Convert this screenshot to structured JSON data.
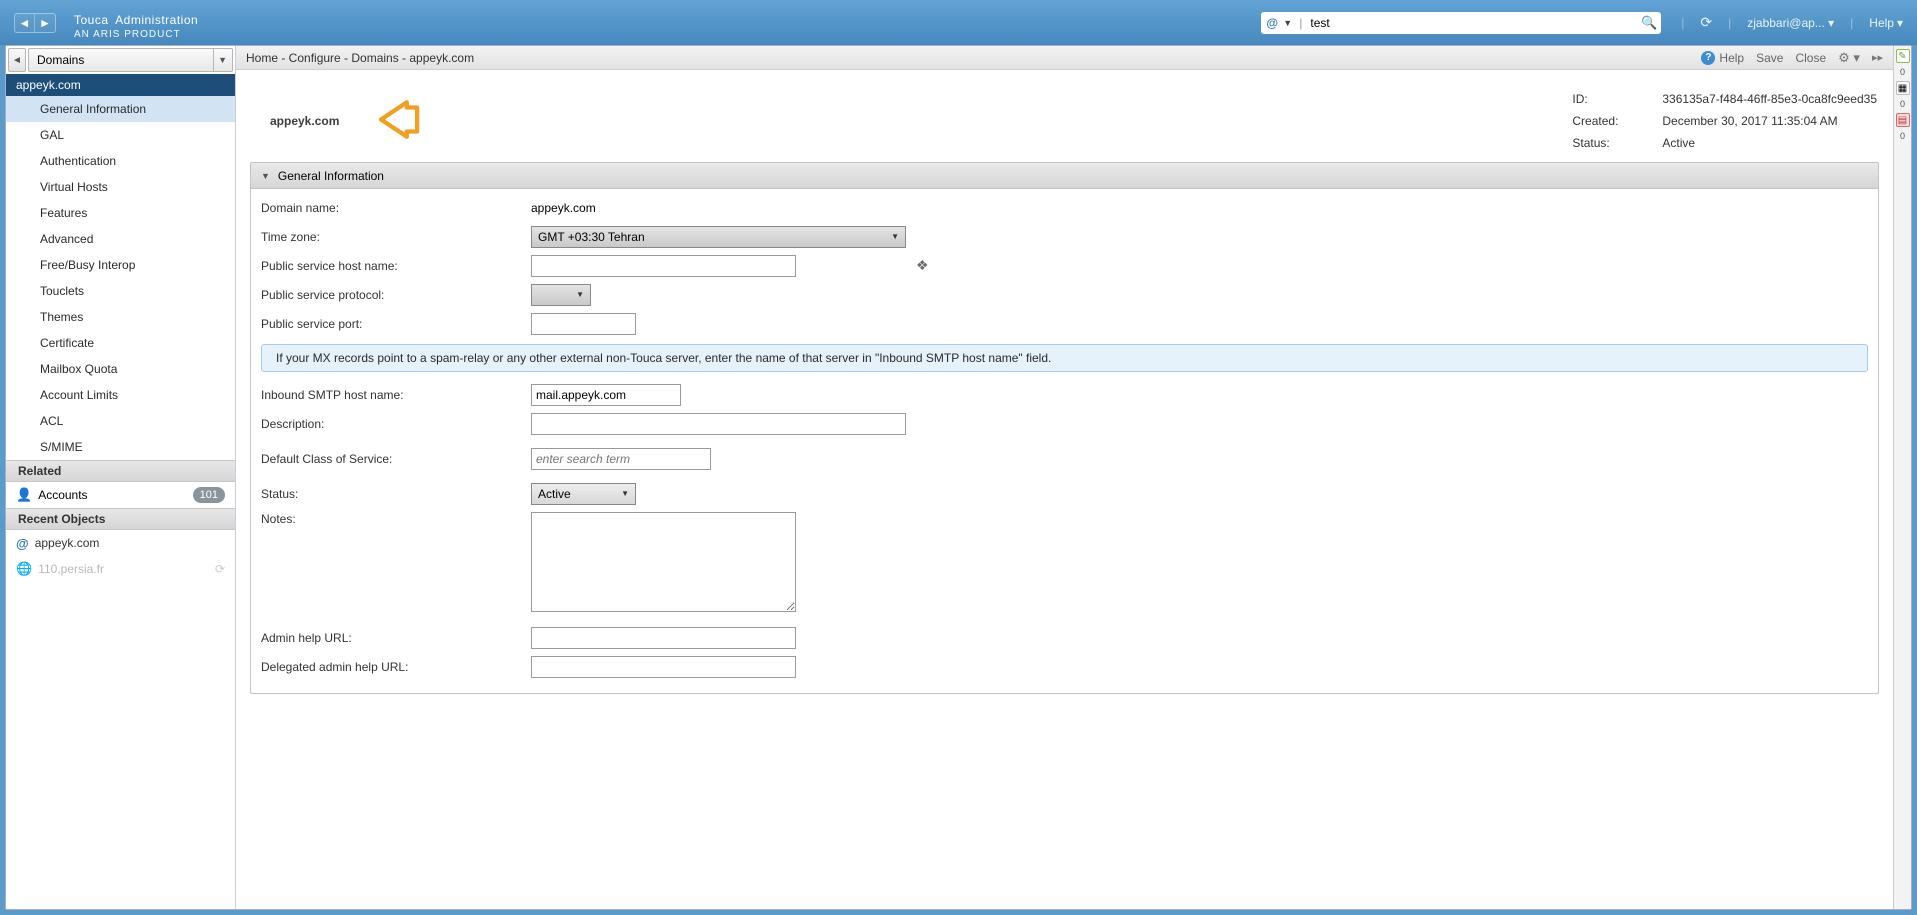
{
  "app": {
    "brand_main": "Touca",
    "brand_rest": "Administration",
    "brand_sub": "AN ARIS PRODUCT"
  },
  "topbar": {
    "search_prefix": "@",
    "search_value": "test",
    "refresh_tip": "Refresh",
    "user": "zjabbari@ap...",
    "help": "Help"
  },
  "sidebar": {
    "selector": "Domains",
    "root": "appeyk.com",
    "items": [
      "General Information",
      "GAL",
      "Authentication",
      "Virtual Hosts",
      "Features",
      "Advanced",
      "Free/Busy Interop",
      "Touclets",
      "Themes",
      "Certificate",
      "Mailbox Quota",
      "Account Limits",
      "ACL",
      "S/MIME"
    ],
    "related_hdr": "Related",
    "related_item": "Accounts",
    "related_badge": "101",
    "recent_hdr": "Recent Objects",
    "recent": [
      {
        "icon": "at",
        "text": "appeyk.com"
      },
      {
        "icon": "globe",
        "text": "110,persia.fr"
      }
    ]
  },
  "breadcrumb": "Home - Configure - Domains - appeyk.com",
  "subheader": {
    "help": "Help",
    "save": "Save",
    "close": "Close"
  },
  "domain": {
    "title": "appeyk.com",
    "meta": {
      "id_lbl": "ID:",
      "id": "336135a7-f484-46ff-85e3-0ca8fc9eed35",
      "created_lbl": "Created:",
      "created": "December 30, 2017 11:35:04 AM",
      "status_lbl": "Status:",
      "status": "Active"
    }
  },
  "group": {
    "title": "General Information",
    "fields": {
      "domain_name_lbl": "Domain name:",
      "domain_name": "appeyk.com",
      "timezone_lbl": "Time zone:",
      "timezone": "GMT +03:30 Tehran",
      "public_host_lbl": "Public service host name:",
      "public_host": "",
      "public_proto_lbl": "Public service protocol:",
      "public_proto": "",
      "public_port_lbl": "Public service port:",
      "public_port": "",
      "mx_info": "If your MX records point to a spam-relay or any other external non-Touca server, enter the name of that server in \"Inbound SMTP host name\" field.",
      "smtp_lbl": "Inbound SMTP host name:",
      "smtp": "mail.appeyk.com",
      "desc_lbl": "Description:",
      "desc": "",
      "cos_lbl": "Default Class of Service:",
      "cos_placeholder": "enter search term",
      "status2_lbl": "Status:",
      "status2": "Active",
      "notes_lbl": "Notes:",
      "notes": "",
      "admin_help_lbl": "Admin help URL:",
      "admin_help": "",
      "delegated_help_lbl": "Delegated admin help URL:",
      "delegated_help": ""
    }
  },
  "rail": {
    "c1": "0",
    "c2": "0",
    "c3": "0"
  }
}
